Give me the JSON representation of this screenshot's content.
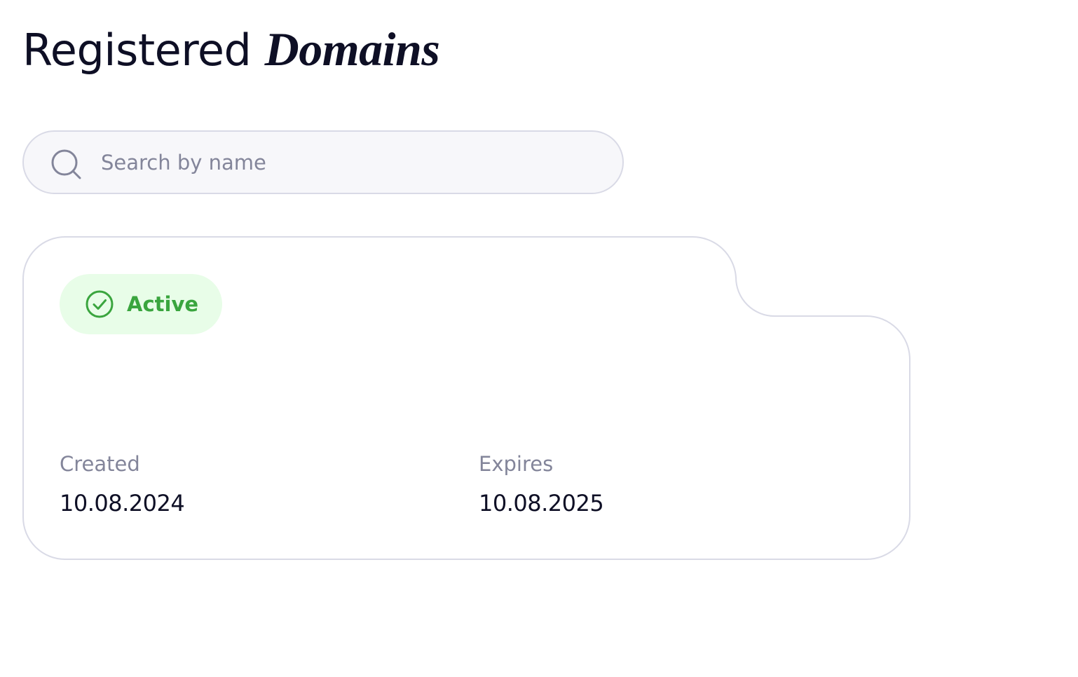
{
  "page": {
    "title_regular": "Registered",
    "title_emphasis": "Domains"
  },
  "search": {
    "placeholder": "Search by name",
    "value": "",
    "icon": "search-icon"
  },
  "domain_card": {
    "status": {
      "label": "Active",
      "icon": "check-circle-icon",
      "text_color": "#3aa53e",
      "background_color": "#e8fde8"
    },
    "created": {
      "label": "Created",
      "value": "10.08.2024"
    },
    "expires": {
      "label": "Expires",
      "value": "10.08.2025"
    }
  },
  "colors": {
    "text_primary": "#0e0f25",
    "text_muted": "#83859a",
    "border": "#d9dae6",
    "input_background": "#f7f7fa"
  }
}
